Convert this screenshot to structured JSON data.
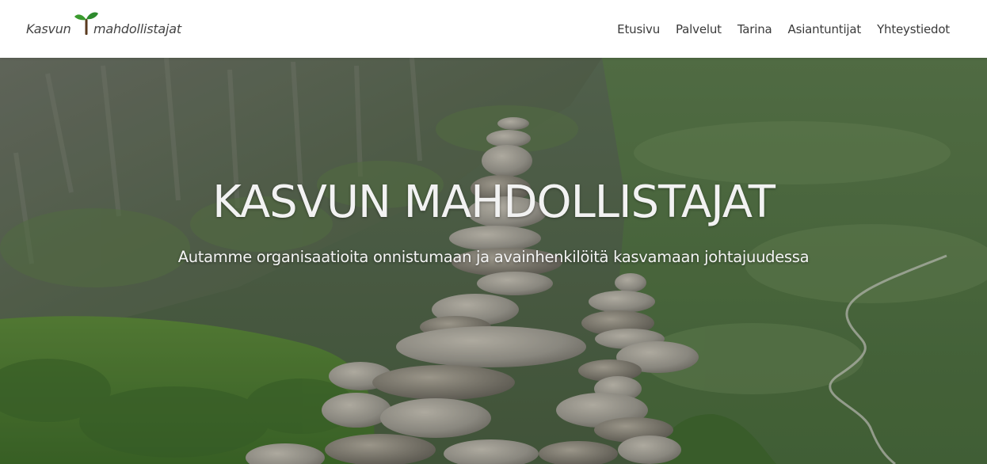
{
  "logo": {
    "text_left": "Kasvun",
    "text_right": "mahdollistajat",
    "icon": "sprout-icon",
    "icon_color": "#2e8b2e"
  },
  "nav": {
    "items": [
      {
        "label": "Etusivu"
      },
      {
        "label": "Palvelut"
      },
      {
        "label": "Tarina"
      },
      {
        "label": "Asiantuntijat"
      },
      {
        "label": "Yhteystiedot"
      }
    ]
  },
  "hero": {
    "title": "KASVUN MAHDOLLISTAJAT",
    "subtitle": "Autamme organisaatioita onnistumaan ja avainhenkilöitä kasvamaan johtajuudessa",
    "background": "mountain-valley-stone-cairn-photo"
  },
  "colors": {
    "nav_text": "#3a3a3a",
    "hero_text": "#f2f2f2",
    "valley_green": "#4d6b44",
    "stone_grey": "#a39f96"
  }
}
